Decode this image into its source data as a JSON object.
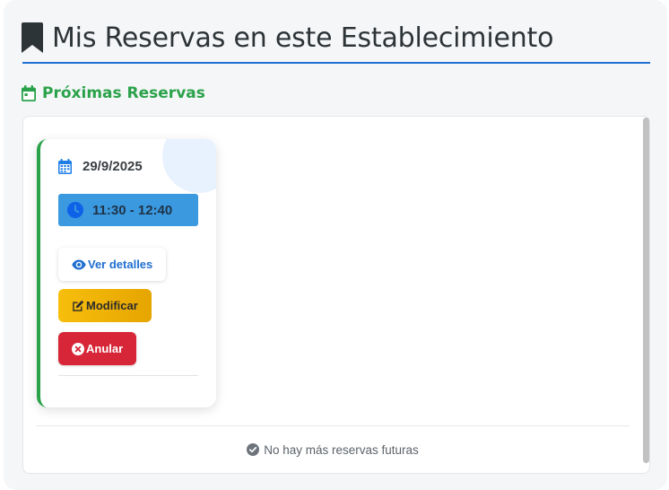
{
  "header": {
    "title": "Mis Reservas en este Establecimiento",
    "icon": "bookmark-icon"
  },
  "section": {
    "title": "Próximas Reservas",
    "icon": "calendar-icon"
  },
  "reservations": [
    {
      "date": "29/9/2025",
      "time": "11:30 - 12:40",
      "status_color": "#2aa24a",
      "actions": {
        "details_label": "Ver detalles",
        "edit_label": "Modificar",
        "cancel_label": "Anular"
      }
    }
  ],
  "footer": {
    "note": "No hay más reservas futuras",
    "icon": "check-circle-icon"
  },
  "colors": {
    "accent": "#1f6fd1",
    "success": "#2aa24a",
    "warning": "#f7be0c",
    "danger": "#d72638"
  }
}
